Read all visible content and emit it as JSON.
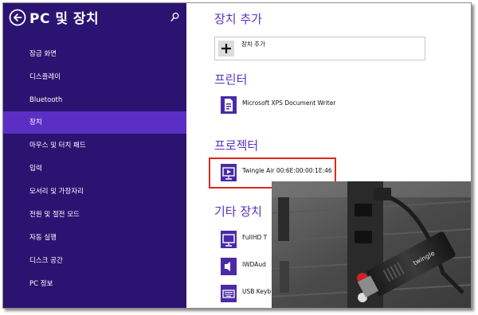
{
  "header": {
    "title": "PC 및 장치"
  },
  "sidebar": {
    "items": [
      {
        "label": "잠금 화면"
      },
      {
        "label": "디스플레이"
      },
      {
        "label": "Bluetooth"
      },
      {
        "label": "장치",
        "active": true
      },
      {
        "label": "마우스 및 터치 패드"
      },
      {
        "label": "입력"
      },
      {
        "label": "모서리 및 가장자리"
      },
      {
        "label": "전원 및 절전 모드"
      },
      {
        "label": "자동 실행"
      },
      {
        "label": "디스크 공간"
      },
      {
        "label": "PC 정보"
      }
    ]
  },
  "main": {
    "add_section": {
      "title": "장치 추가",
      "button_label": "장치 추가"
    },
    "printers": {
      "title": "프린터",
      "devices": [
        {
          "label": "Microsoft XPS Document Writer",
          "icon": "printer-icon"
        }
      ]
    },
    "projectors": {
      "title": "프로젝터",
      "devices": [
        {
          "label": "Twingle Air 00:6E:00:00:1E:46",
          "icon": "projector-icon"
        }
      ]
    },
    "other": {
      "title": "기타 장치",
      "devices": [
        {
          "label": "FullHD T",
          "icon": "monitor-icon"
        },
        {
          "label": "IWDAud",
          "icon": "speaker-icon"
        },
        {
          "label": "USB Keyb",
          "icon": "keyboard-icon"
        }
      ]
    }
  },
  "photo": {
    "brand": "twingle"
  },
  "colors": {
    "sidebar_bg": "#2b1372",
    "active_item": "#5b2fc4",
    "accent": "#5a31c2",
    "highlight_box": "#e1261c"
  }
}
